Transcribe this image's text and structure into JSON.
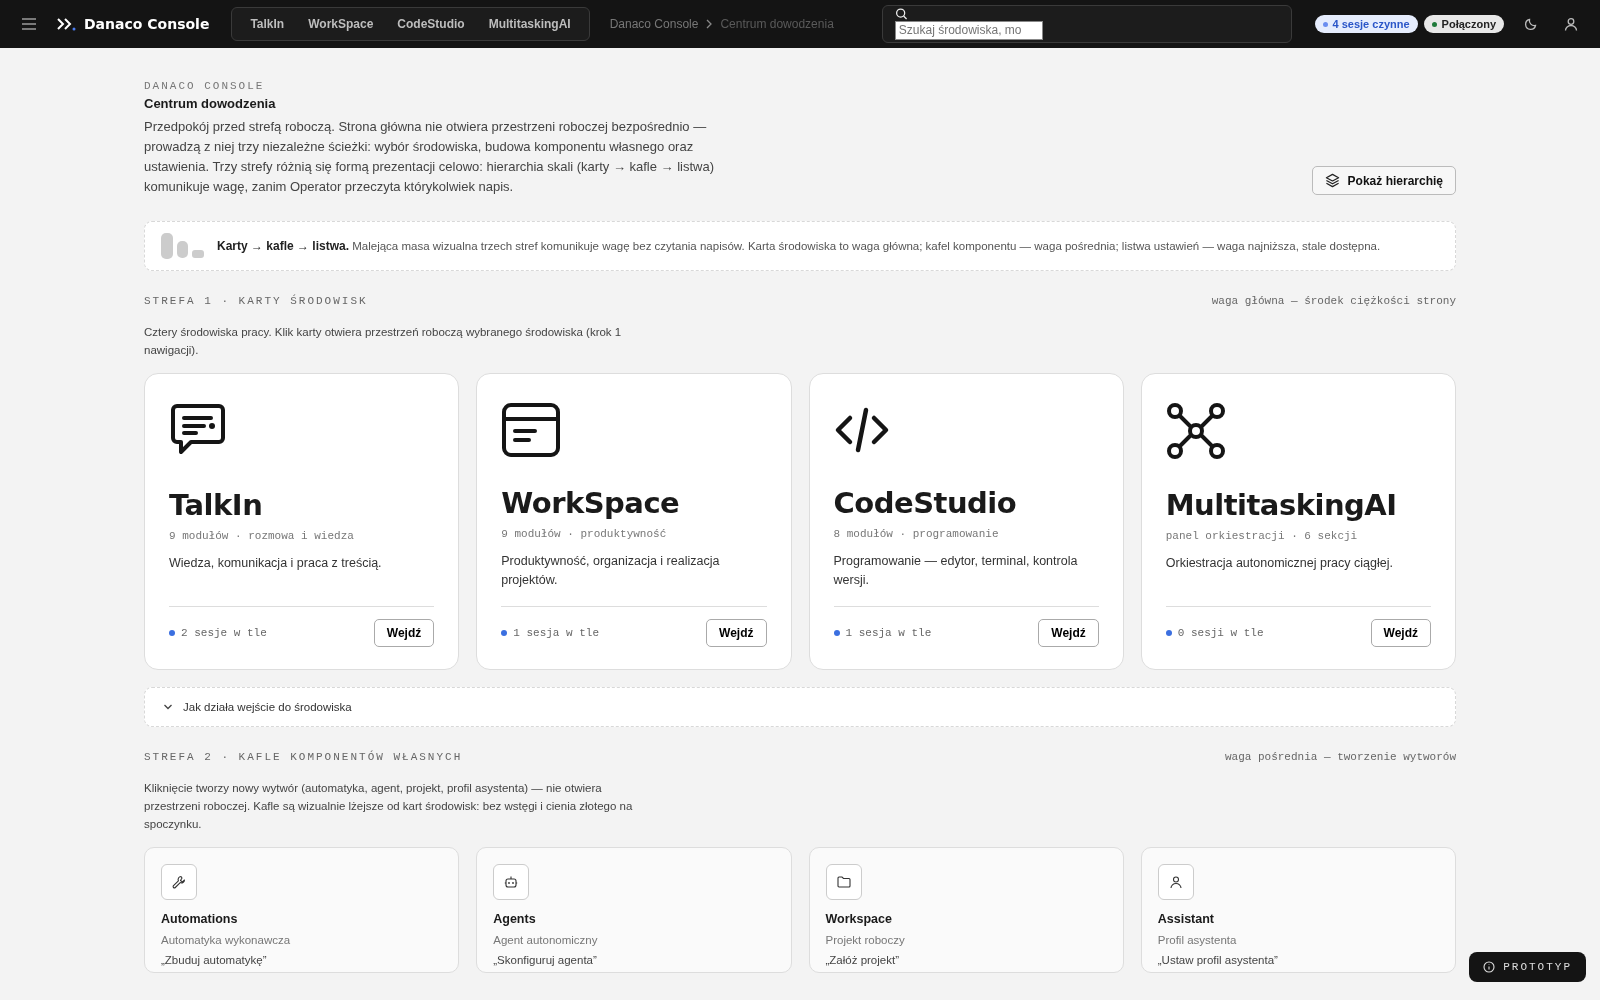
{
  "header": {
    "brand": "Danaco Console",
    "nav_tabs": [
      {
        "label": "TalkIn",
        "selected": false
      },
      {
        "label": "WorkSpace",
        "selected": false
      },
      {
        "label": "CodeStudio",
        "selected": false
      },
      {
        "label": "MultitaskingAI",
        "selected": false
      }
    ],
    "breadcrumb": [
      "Danaco Console",
      "Centrum dowodzenia"
    ],
    "search": {
      "placeholder": "Szukaj środowiska, mo"
    },
    "status_pills": [
      {
        "label": "4 sesje czynne",
        "color": "#6b8ef0"
      },
      {
        "label": "Połączony",
        "color": "#1f7a3a"
      }
    ]
  },
  "intro": {
    "eyebrow": "DANACO CONSOLE",
    "title": "Centrum dowodzenia",
    "text": "Przedpokój przed strefą roboczą. Strona główna nie otwiera przestrzeni roboczej bezpośrednio — prowadzą z niej trzy niezależne ścieżki: wybór środowiska, budowa komponentu własnego oraz ustawienia. Trzy strefy różnią się formą prezentacji celowo: hierarchia skali (karty → kafle → listwa) komunikuje wagę, zanim Operator przeczyta którykolwiek napis.",
    "button": "Pokaż hierarchię"
  },
  "note": "**Karty → kafle → listwa.** Malejąca masa wizualna trzech stref komunikuje wagę bez czytania napisów. Karta środowiska to waga główna; kafel komponentu — waga pośrednia; listwa ustawień — waga najniższa, stale dostępna.",
  "zone1": {
    "heading": "STREFA 1 · KARTY ŚRODOWISK",
    "aside": "waga główna — środek ciężkości strony",
    "text": "Cztery środowiska pracy. Klik karty otwiera przestrzeń roboczą wybranego środowiska (krok 1 nawigacji).",
    "cards": [
      {
        "kind": "chat",
        "title": "TalkIn",
        "meta": "9 modułów · rozmowa i wiedza",
        "description": "Wiedza, komunikacja i praca z treścią.",
        "sessions": "2 sesje w tle",
        "button": "Wejdź"
      },
      {
        "kind": "window",
        "title": "WorkSpace",
        "meta": "9 modułów · produktywność",
        "description": "Produktywność, organizacja i realizacja projektów.",
        "sessions": "1 sesja w tle",
        "button": "Wejdź"
      },
      {
        "kind": "code",
        "title": "CodeStudio",
        "meta": "8 modułów · programowanie",
        "description": "Programowanie — edytor, terminal, kontrola wersji.",
        "sessions": "1 sesja w tle",
        "button": "Wejdź"
      },
      {
        "kind": "network",
        "title": "MultitaskingAI",
        "meta": "panel orkiestracji · 6 sekcji",
        "description": "Orkiestracja autonomicznej pracy ciągłej.",
        "sessions": "0 sesji w tle",
        "button": "Wejdź"
      }
    ],
    "expander": {
      "label": "Jak działa wejście do środowiska",
      "expanded": false
    }
  },
  "zone2": {
    "heading": "STREFA 2 · KAFLE KOMPONENTÓW WŁASNYCH",
    "aside": "waga pośrednia — tworzenie wytworów",
    "text": "Kliknięcie tworzy nowy wytwór (automatyka, agent, projekt, profil asystenta) — nie otwiera przestrzeni roboczej. Kafle są wizualnie lżejsze od kart środowisk: bez wstęgi i cienia złotego na spoczynku.",
    "tiles": [
      {
        "kind": "wrench",
        "title": "Automations",
        "subtitle": "Automatyka wykonawcza",
        "action": "„Zbuduj automatykę”"
      },
      {
        "kind": "robot",
        "title": "Agents",
        "subtitle": "Agent autonomiczny",
        "action": "„Skonfiguruj agenta”"
      },
      {
        "kind": "folder",
        "title": "Workspace",
        "subtitle": "Projekt roboczy",
        "action": "„Załóż projekt”"
      },
      {
        "kind": "person",
        "title": "Assistant",
        "subtitle": "Profil asystenta",
        "action": "„Ustaw profil asystenta”"
      }
    ]
  },
  "badge": "PROTOTYP"
}
